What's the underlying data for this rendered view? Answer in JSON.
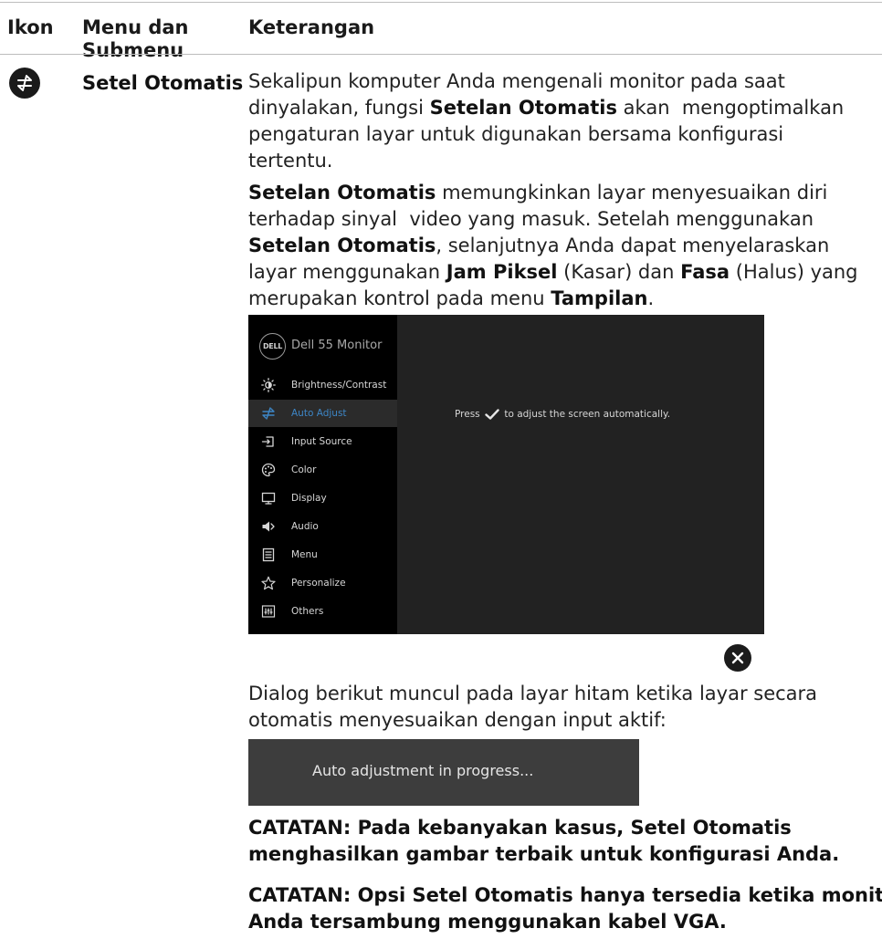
{
  "table": {
    "headers": [
      "Ikon",
      "Menu dan Submenu",
      "Keterangan"
    ],
    "header_menu_line1": "Menu dan",
    "header_menu_line2": "Submenu"
  },
  "row": {
    "icon": "auto-adjust-icon",
    "menu_name": "Setel Otomatis",
    "para1": {
      "line1": "Sekalipun komputer Anda mengenali monitor pada saat",
      "line2_pre": "dinyalakan, fungsi ",
      "line2_bold": "Setelan Otomatis",
      "line2_post": " akan  mengoptimalkan",
      "line3": "pengaturan layar untuk digunakan bersama konfigurasi",
      "line4": "tertentu."
    },
    "para2": {
      "line1_bold": "Setelan Otomatis",
      "line1_post": " memungkinkan layar menyesuaikan diri",
      "line2": "terhadap sinyal  video yang masuk. Setelah menggunakan",
      "line3_bold": "Setelan Otomatis",
      "line3_post": ", selanjutnya Anda dapat menyelaraskan",
      "line4_pre": "layar menggunakan ",
      "line4_bold1": "Jam Piksel",
      "line4_mid": " (Kasar) dan ",
      "line4_bold2": "Fasa",
      "line4_post": " (Halus) yang",
      "line5_pre": "merupakan kontrol pada menu ",
      "line5_bold": "Tampilan",
      "line5_post": "."
    },
    "para3": {
      "line1": "Dialog berikut muncul pada layar hitam ketika layar secara",
      "line2": "otomatis menyesuaikan dengan input aktif:"
    },
    "note1": {
      "line1": "CATATAN: Pada kebanyakan kasus, Setel Otomatis",
      "line2": "menghasilkan gambar terbaik untuk konfigurasi Anda."
    },
    "note2": {
      "line1": "CATATAN: Opsi Setel Otomatis hanya tersedia ketika monitor",
      "line2": "Anda tersambung menggunakan kabel VGA."
    }
  },
  "osd": {
    "logo_text": "DELL",
    "title": "Dell 55 Monitor",
    "menu": [
      {
        "label": "Brightness/Contrast",
        "icon": "brightness-icon"
      },
      {
        "label": "Auto Adjust",
        "icon": "auto-adjust-icon",
        "active": true
      },
      {
        "label": "Input Source",
        "icon": "input-source-icon"
      },
      {
        "label": "Color",
        "icon": "color-palette-icon"
      },
      {
        "label": "Display",
        "icon": "display-icon"
      },
      {
        "label": "Audio",
        "icon": "speaker-icon"
      },
      {
        "label": "Menu",
        "icon": "menu-icon"
      },
      {
        "label": "Personalize",
        "icon": "star-icon"
      },
      {
        "label": "Others",
        "icon": "others-icon"
      }
    ],
    "message_pre": "Press",
    "message_post": "to adjust the screen automatically.",
    "active_color": "#3d86c6"
  },
  "close_button": {
    "icon": "close-icon"
  },
  "dialog": {
    "text": "Auto adjustment in progress..."
  }
}
